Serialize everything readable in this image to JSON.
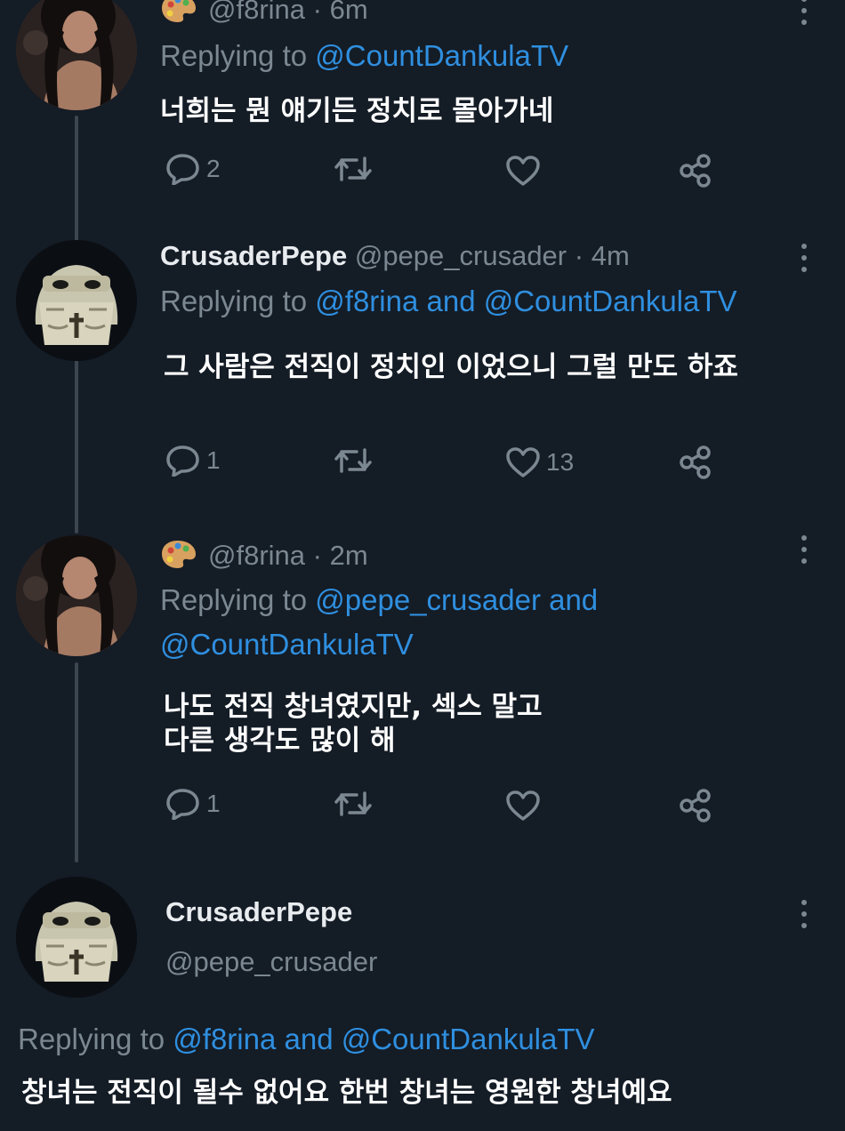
{
  "tweets": [
    {
      "handle": "@f8rina",
      "time": "· 6m",
      "replying_prefix": "Replying to",
      "replying_mentions": "@CountDankulaTV",
      "text": "너희는 뭔 얘기든 정치로 몰아가네",
      "reply_count": "2",
      "retweet_count": "",
      "like_count": "",
      "avatar_icon": "woman-avatar"
    },
    {
      "name": "CrusaderPepe",
      "handle": "@pepe_crusader",
      "time": "· 4m",
      "replying_prefix": "Replying to",
      "replying_mentions": "@f8rina and @CountDankulaTV",
      "text": "그 사람은 전직이 정치인 이었으니 그럴 만도 하죠",
      "reply_count": "1",
      "retweet_count": "",
      "like_count": "13",
      "avatar_icon": "pepe-avatar"
    },
    {
      "handle": "@f8rina",
      "time": "· 2m",
      "replying_prefix": "Replying to",
      "replying_mentions_line1": "@pepe_crusader and",
      "replying_mentions_line2": "@CountDankulaTV",
      "text_line1": "나도 전직 창녀였지만, 섹스 말고",
      "text_line2": "다른 생각도 많이 해",
      "reply_count": "1",
      "retweet_count": "",
      "like_count": "",
      "avatar_icon": "woman-avatar"
    },
    {
      "name": "CrusaderPepe",
      "handle": "@pepe_crusader",
      "replying_prefix": "Replying to",
      "replying_mentions": "@f8rina and @CountDankulaTV",
      "text": "창녀는 전직이 될수 없어요 한번 창녀는 영원한 창녀예요",
      "avatar_icon": "pepe-avatar"
    }
  ],
  "colors": {
    "background": "#141c26",
    "mention": "#2f8fdf",
    "muted": "#7b8791",
    "text": "#ffffff"
  }
}
